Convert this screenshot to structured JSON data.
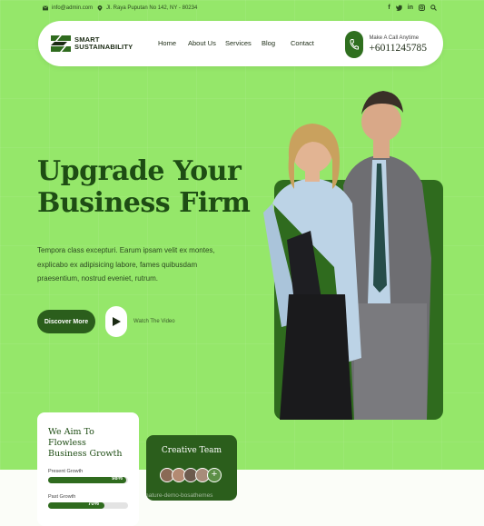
{
  "topbar": {
    "email": "info@admin.com",
    "address": "Jl. Raya Puputan No 142, NY - 80234",
    "social": [
      "f",
      "t",
      "in",
      "ig",
      "search"
    ]
  },
  "header": {
    "logo_line1": "SMART",
    "logo_line2": "SUSTAINABILITY",
    "nav": [
      "Home",
      "About Us",
      "Services",
      "Blog",
      "Contact"
    ],
    "call_label": "Make A Call Anytime",
    "call_number": "+6011245785"
  },
  "hero": {
    "title_line1": "Upgrade Your",
    "title_line2": "Business Firm",
    "description": "Tempora class excepturi. Earum ipsam velit ex montes, explicabo ex adipisicing labore, fames quibusdam praesentium, nostrud eveniet, rutrum.",
    "discover_label": "Discover More",
    "watch_label": "Watch The Video"
  },
  "growth_card": {
    "title_line1": "We Aim To Flowless",
    "title_line2": "Business Growth",
    "bars": [
      {
        "label": "Present Growth",
        "value_label": "98%",
        "value": 0.98
      },
      {
        "label": "Past Growth",
        "value_label": "70%",
        "value": 0.7
      }
    ]
  },
  "team_card": {
    "title": "Creative Team",
    "plus": "+"
  },
  "watermark": "nature-demo-bosathemes",
  "colors": {
    "background": "#95e76a",
    "brand_dark": "#2b5e1c",
    "accent_card": "#2f6b1e"
  }
}
